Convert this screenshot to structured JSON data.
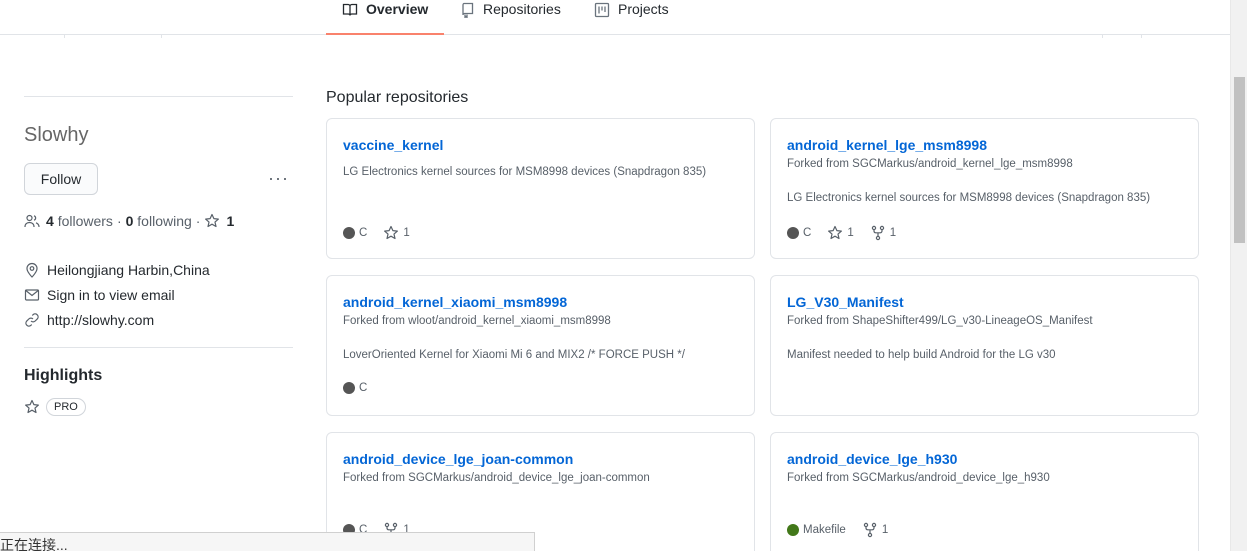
{
  "tabs": [
    {
      "label": "Overview",
      "icon": "book-icon",
      "active": true
    },
    {
      "label": "Repositories",
      "icon": "repo-icon",
      "active": false
    },
    {
      "label": "Projects",
      "icon": "project-icon",
      "active": false
    }
  ],
  "profile": {
    "name": "Slowhy",
    "follow_label": "Follow",
    "more_label": "···",
    "followers_count": "4",
    "followers_label": "followers",
    "sep": "·",
    "following_count": "0",
    "following_label": "following",
    "stars_count": "1",
    "location": "Heilongjiang Harbin,China",
    "email": "Sign in to view email",
    "website": "http://slowhy.com"
  },
  "highlights": {
    "title": "Highlights",
    "badge": "PRO"
  },
  "section_title": "Popular repositories",
  "repos": [
    {
      "name": "vaccine_kernel",
      "forked": "",
      "desc": "LG Electronics kernel sources for MSM8998 devices (Snapdragon 835)",
      "lang": "C",
      "lang_color": "#555555",
      "stars": "1",
      "forks": ""
    },
    {
      "name": "android_kernel_lge_msm8998",
      "forked": "Forked from SGCMarkus/android_kernel_lge_msm8998",
      "desc": "LG Electronics kernel sources for MSM8998 devices (Snapdragon 835)",
      "lang": "C",
      "lang_color": "#555555",
      "stars": "1",
      "forks": "1"
    },
    {
      "name": "android_kernel_xiaomi_msm8998",
      "forked": "Forked from wloot/android_kernel_xiaomi_msm8998",
      "desc": "LoverOriented Kernel for Xiaomi Mi 6 and MIX2 /* FORCE PUSH */",
      "lang": "C",
      "lang_color": "#555555",
      "stars": "",
      "forks": ""
    },
    {
      "name": "LG_V30_Manifest",
      "forked": "Forked from ShapeShifter499/LG_v30-LineageOS_Manifest",
      "desc": "Manifest needed to help build Android for the LG v30",
      "lang": "",
      "lang_color": "",
      "stars": "",
      "forks": ""
    },
    {
      "name": "android_device_lge_joan-common",
      "forked": "Forked from SGCMarkus/android_device_lge_joan-common",
      "desc": "",
      "lang": "C",
      "lang_color": "#555555",
      "stars": "",
      "forks": "1"
    },
    {
      "name": "android_device_lge_h930",
      "forked": "Forked from SGCMarkus/android_device_lge_h930",
      "desc": "",
      "lang": "Makefile",
      "lang_color": "#427819",
      "stars": "",
      "forks": "1"
    }
  ],
  "status_bar": "正在连接..."
}
